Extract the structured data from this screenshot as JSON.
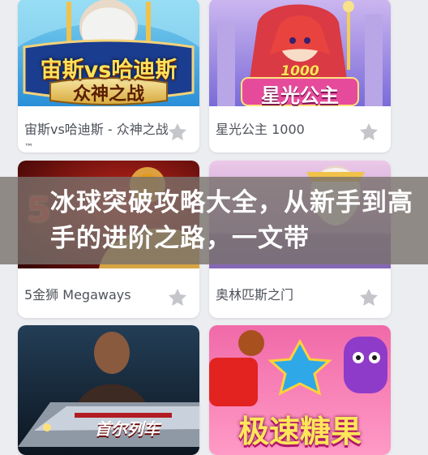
{
  "games": [
    {
      "title": "宙斯vs哈迪斯 - 众神之战",
      "title_suffix": "™",
      "logo_line1": "宙斯vs哈迪斯",
      "logo_line2": "众神之战",
      "favorite": false
    },
    {
      "title": "星光公主 1000",
      "logo_line1": "1000",
      "logo_line2": "星光公主",
      "favorite": false
    },
    {
      "title": "5金狮 Megaways",
      "logo_line1": "5",
      "favorite": false
    },
    {
      "title": "奥林匹斯之门",
      "favorite": false
    },
    {
      "title": "首尔列车",
      "logo_line1": "首尔列车",
      "favorite": false
    },
    {
      "title": "极速糖果",
      "logo_line1": "极速糖果",
      "favorite": false
    }
  ],
  "banner": {
    "text": "冰球突破攻略大全，从新手到高手的进阶之路，一文带"
  },
  "colors": {
    "page_bg": "#ecedf1",
    "card_bg": "#ffffff",
    "caption_text": "#4e5259",
    "star_icon": "#c4c6cb",
    "banner_bg": "rgba(120,112,108,0.80)"
  },
  "icons": {
    "favorite": "star-icon"
  }
}
